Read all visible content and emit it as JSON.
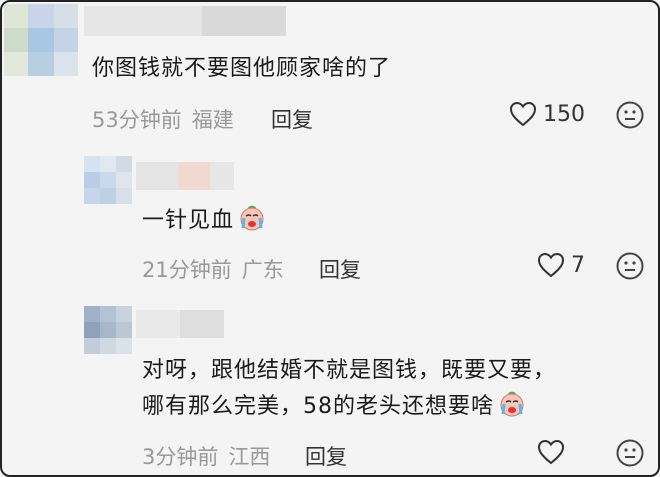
{
  "comments": [
    {
      "text_lines": [
        "你图钱就不要图他顾家啥的了"
      ],
      "time": "53分钟前",
      "location": "福建",
      "reply_label": "回复",
      "likes": "150"
    },
    {
      "text_lines": [
        "一针见血"
      ],
      "emoji": "crying-face-icon",
      "time": "21分钟前",
      "location": "广东",
      "reply_label": "回复",
      "likes": "7"
    },
    {
      "text_lines": [
        "对呀，跟他结婚不就是图钱，既要又要，",
        "哪有那么完美，58的老头还想要啥"
      ],
      "emoji": "crying-face-icon",
      "time": "3分钟前",
      "location": "江西",
      "reply_label": "回复",
      "likes": ""
    }
  ],
  "colors": {
    "background": "#f4f4f4",
    "meta": "#999999",
    "text": "#1a1a1a"
  }
}
